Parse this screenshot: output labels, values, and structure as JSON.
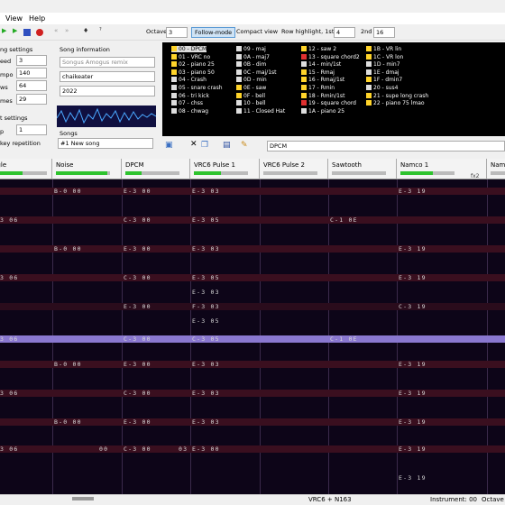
{
  "menu": {
    "view": "View",
    "help": "Help"
  },
  "toolbar": {
    "octave_label": "Octave",
    "octave_value": "3",
    "follow_mode": "Follow-mode",
    "compact_view": "Compact view",
    "row_highlight_label": "Row highlight, 1st",
    "row_highlight_value": "4",
    "second_label": "2nd",
    "second_value": "16"
  },
  "song_settings": {
    "title": "ng settings",
    "speed_label": "eed",
    "speed_value": "3",
    "tempo_label": "mpo",
    "tempo_value": "140",
    "rows_label": "ws",
    "rows_value": "64",
    "frames_label": "mes",
    "frames_value": "29",
    "edit_title": "t settings",
    "step_label": "p",
    "step_value": "1",
    "key_rep": "key repetition"
  },
  "song_info": {
    "title": "Song information",
    "name": "Songus Amogus remix",
    "author": "chaikeater",
    "year": "2022",
    "songs_label": "Songs",
    "song_select": "#1 New song"
  },
  "instruments": [
    {
      "t": "00 - DPCM",
      "c": "#ffd42a"
    },
    {
      "t": "01 - VRC no",
      "c": "#ffd42a"
    },
    {
      "t": "02 - piano 25",
      "c": "#ffd42a"
    },
    {
      "t": "03 - piano 50",
      "c": "#ffd42a"
    },
    {
      "t": "04 - Crash",
      "c": "#ddd"
    },
    {
      "t": "05 - snare crash",
      "c": "#ddd"
    },
    {
      "t": "06 - tri kick",
      "c": "#ddd"
    },
    {
      "t": "07 - chss",
      "c": "#ddd"
    },
    {
      "t": "08 - chwag",
      "c": "#ddd"
    },
    {
      "t": "09 - maj",
      "c": "#ddd"
    },
    {
      "t": "0A - maj7",
      "c": "#ddd"
    },
    {
      "t": "0B - dim",
      "c": "#ddd"
    },
    {
      "t": "0C - maj/1st",
      "c": "#ddd"
    },
    {
      "t": "0D - min",
      "c": "#ddd"
    },
    {
      "t": "0E - saw",
      "c": "#ffd42a"
    },
    {
      "t": "0F - bell",
      "c": "#ffd42a"
    },
    {
      "t": "10 - bell",
      "c": "#ddd"
    },
    {
      "t": "11 - Closed Hat",
      "c": "#ddd"
    },
    {
      "t": "12 - saw 2",
      "c": "#ffd42a"
    },
    {
      "t": "13 - square chord2",
      "c": "#e03030"
    },
    {
      "t": "14 - min/1st",
      "c": "#ddd"
    },
    {
      "t": "15 - Rmaj",
      "c": "#ffd42a"
    },
    {
      "t": "16 - Rmaj/1st",
      "c": "#ffd42a"
    },
    {
      "t": "17 - Rmin",
      "c": "#ffd42a"
    },
    {
      "t": "18 - Rmin/1st",
      "c": "#ffd42a"
    },
    {
      "t": "19 - square chord",
      "c": "#e03030"
    },
    {
      "t": "1A - piano 25",
      "c": "#ddd"
    },
    {
      "t": "1B - VR lin",
      "c": "#ffd42a"
    },
    {
      "t": "1C - VR lon",
      "c": "#ffd42a"
    },
    {
      "t": "1D - min7",
      "c": "#ddd"
    },
    {
      "t": "1E - dmaj",
      "c": "#ddd"
    },
    {
      "t": "1F - dmin7",
      "c": "#ffd42a"
    },
    {
      "t": "20 - sus4",
      "c": "#ddd"
    },
    {
      "t": "21 - supe long crash",
      "c": "#ffd42a"
    },
    {
      "t": "22 - piano 75 lmao",
      "c": "#ffd42a"
    }
  ],
  "instrument_name": "DPCM",
  "channels": [
    {
      "name": "ngle",
      "meter": 0.55
    },
    {
      "name": "Noise",
      "meter": 0.95
    },
    {
      "name": "DPCM",
      "meter": 0.3
    },
    {
      "name": "VRC6 Pulse 1",
      "meter": 0.5
    },
    {
      "name": "VRC6 Pulse 2",
      "meter": 0
    },
    {
      "name": "Sawtooth",
      "meter": 0
    },
    {
      "name": "Namco 1",
      "meter": 0.6
    },
    {
      "name": "Nam",
      "meter": 0
    }
  ],
  "namco_fx": "fx2",
  "status": {
    "chip": "VRC6 + N163",
    "instrument": "Instrument: 00",
    "octave": "Octave"
  }
}
